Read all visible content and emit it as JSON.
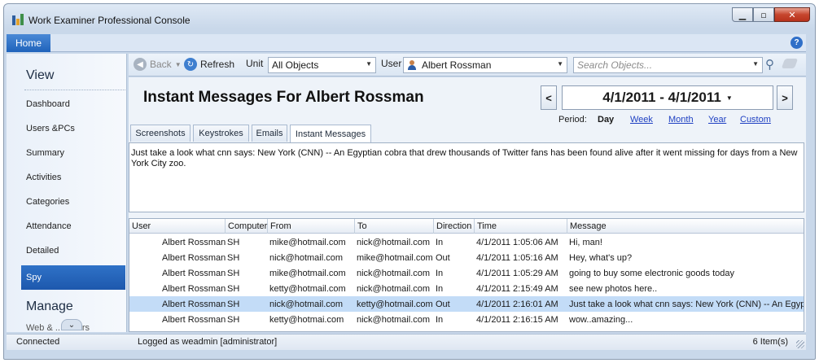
{
  "window": {
    "title": "Work Examiner Professional Console"
  },
  "ribbon": {
    "home_tab": "Home",
    "help": "?"
  },
  "sidebar": {
    "view_heading": "View",
    "items": [
      "Dashboard",
      "Users &PCs",
      "Summary",
      "Activities",
      "Categories",
      "Attendance",
      "Detailed",
      "Spy"
    ],
    "active_item": "Spy",
    "manage_heading": "Manage",
    "manage_first_item_partial": "Web & ... Filters"
  },
  "toolbar": {
    "back_label": "Back",
    "refresh_label": "Refresh",
    "unit_label": "Unit",
    "unit_value": "All Objects",
    "user_label": "User",
    "user_value": "Albert Rossman",
    "search_placeholder": "Search Objects..."
  },
  "header": {
    "title": "Instant Messages For Albert Rossman",
    "prev": "<",
    "next": ">",
    "date_range": "4/1/2011 - 4/1/2011",
    "period_label": "Period:",
    "period_options": [
      "Day",
      "Week",
      "Month",
      "Year",
      "Custom"
    ],
    "period_selected": "Day"
  },
  "tabs": [
    "Screenshots",
    "Keystrokes",
    "Emails",
    "Instant Messages"
  ],
  "active_tab": "Instant Messages",
  "preview_text": "Just take a look what cnn says: New York (CNN) -- An Egyptian cobra that drew thousands of Twitter fans has been found alive after it went missing for days from a New York City zoo.",
  "grid": {
    "columns": [
      "User",
      "Computer",
      "From",
      "To",
      "Direction",
      "Time",
      "Message"
    ],
    "rows": [
      [
        "Albert Rossman",
        "SH",
        "mike@hotmail.com",
        "nick@hotmail.com",
        "In",
        "4/1/2011 1:05:06 AM",
        "Hi, man!"
      ],
      [
        "Albert Rossman",
        "SH",
        "nick@hotmail.com",
        "mike@hotmail.com",
        "Out",
        "4/1/2011 1:05:16 AM",
        "Hey, what's up?"
      ],
      [
        "Albert Rossman",
        "SH",
        "mike@hotmail.com",
        "nick@hotmail.com",
        "In",
        "4/1/2011 1:05:29 AM",
        "going to buy some electronic goods today"
      ],
      [
        "Albert Rossman",
        "SH",
        "ketty@hotmail.com",
        "nick@hotmail.com",
        "In",
        "4/1/2011 2:15:49 AM",
        "see new photos here.."
      ],
      [
        "Albert Rossman",
        "SH",
        "nick@hotmail.com",
        "ketty@hotmail.com",
        "Out",
        "4/1/2011 2:16:01 AM",
        "Just take a look what cnn says: New York (CNN) -- An Egypt"
      ],
      [
        "Albert Rossman",
        "SH",
        "ketty@hotmai.com",
        "nick@hotmail.com",
        "In",
        "4/1/2011 2:16:15 AM",
        "wow..amazing..."
      ]
    ],
    "selected_row": 4
  },
  "status": {
    "connection": "Connected",
    "logged_as": "Logged as weadmin [administrator]",
    "item_count": "6 Item(s)"
  },
  "colors": {
    "accent": "#1f63bb",
    "selection": "#c3dcf7",
    "link": "#1d3fc2"
  }
}
